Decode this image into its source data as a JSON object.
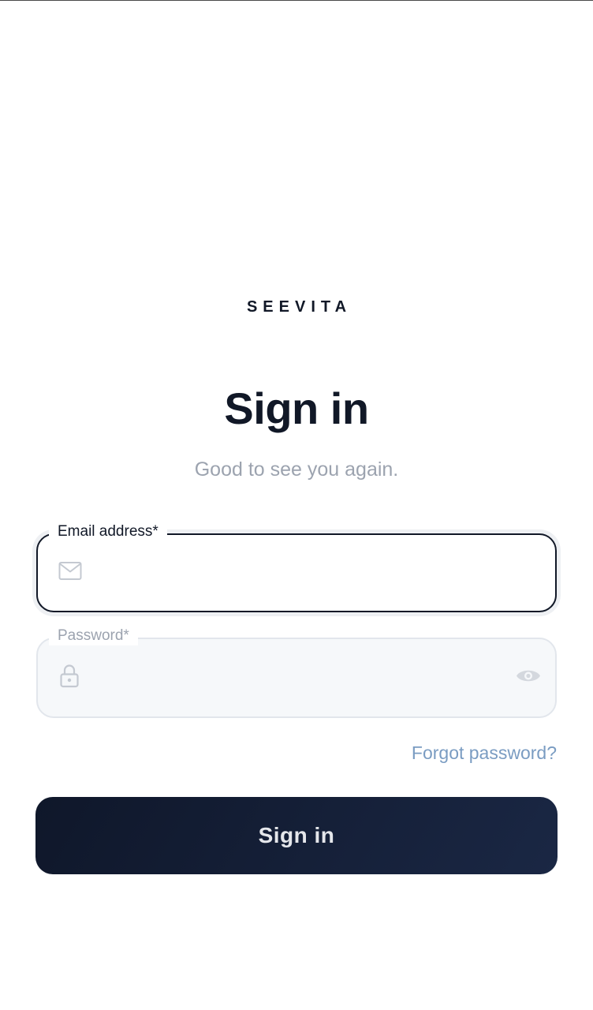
{
  "brand": {
    "name": "SEEVITA"
  },
  "header": {
    "title": "Sign in",
    "subtitle": "Good to see you again."
  },
  "form": {
    "email": {
      "label": "Email address*",
      "value": "",
      "placeholder": "",
      "icon": "mail-icon"
    },
    "password": {
      "label": "Password*",
      "value": "",
      "placeholder": "",
      "icon": "lock-icon",
      "toggle_icon": "eye-icon"
    },
    "forgot_label": "Forgot password?",
    "submit_label": "Sign in"
  },
  "colors": {
    "primary": "#111827",
    "muted": "#9ca3af",
    "link": "#7a9cc2",
    "field_border_inactive": "#e2e6ec",
    "field_bg_inactive": "#f6f8fa"
  }
}
